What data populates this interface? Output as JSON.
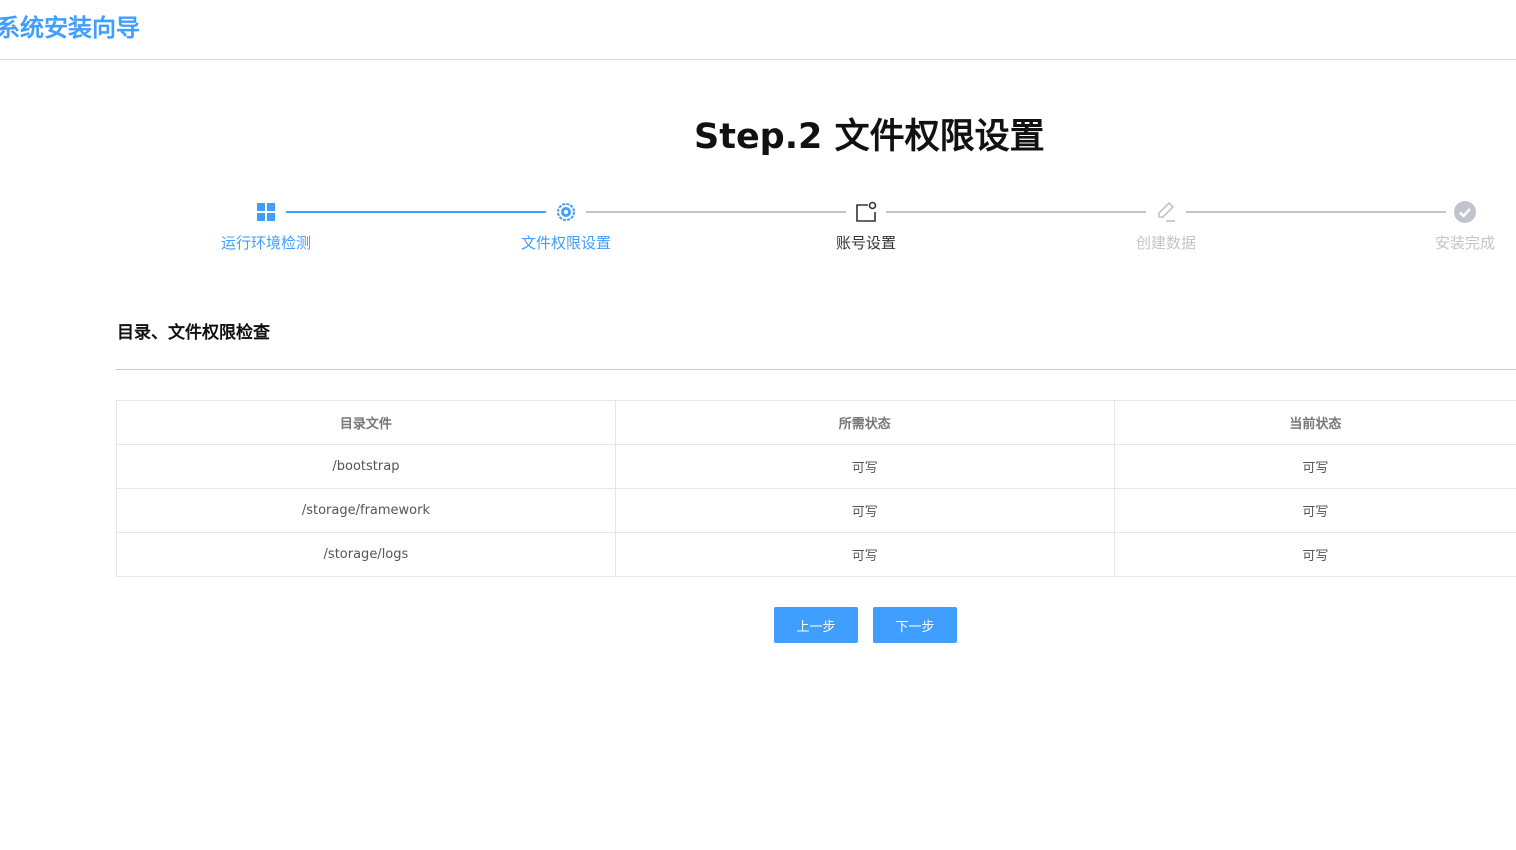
{
  "header": {
    "title": "系统安装向导"
  },
  "page": {
    "title": "Step.2 文件权限设置"
  },
  "steps": [
    {
      "label": "运行环境检测",
      "icon": "grid-icon",
      "state": "done"
    },
    {
      "label": "文件权限设置",
      "icon": "gear-icon",
      "state": "current"
    },
    {
      "label": "账号设置",
      "icon": "account-icon",
      "state": "active"
    },
    {
      "label": "创建数据",
      "icon": "pencil-icon",
      "state": "pending"
    },
    {
      "label": "安装完成",
      "icon": "check-circle-icon",
      "state": "pending"
    }
  ],
  "section": {
    "title": "目录、文件权限检查"
  },
  "table": {
    "headers": [
      "目录文件",
      "所需状态",
      "当前状态"
    ],
    "rows": [
      [
        "/bootstrap",
        "可写",
        "可写"
      ],
      [
        "/storage/framework",
        "可写",
        "可写"
      ],
      [
        "/storage/logs",
        "可写",
        "可写"
      ]
    ]
  },
  "buttons": {
    "prev": "上一步",
    "next": "下一步"
  },
  "colors": {
    "primary": "#409eff",
    "inactive": "#c0c4cc",
    "active_text": "#333333"
  }
}
